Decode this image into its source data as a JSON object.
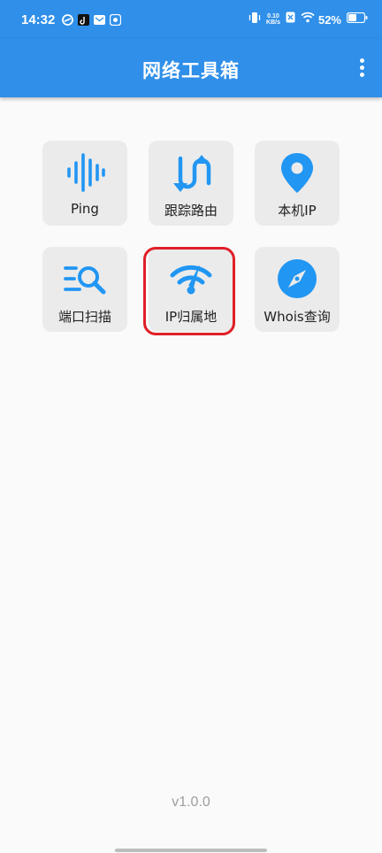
{
  "status_bar": {
    "time": "14:32",
    "net_speed_value": "0.10",
    "net_speed_unit": "KB/s",
    "battery": "52%"
  },
  "app_bar": {
    "title": "网络工具箱"
  },
  "tools": [
    {
      "label": "Ping",
      "icon": "waveform-icon"
    },
    {
      "label": "跟踪路由",
      "icon": "route-arrows-icon"
    },
    {
      "label": "本机IP",
      "icon": "location-pin-icon"
    },
    {
      "label": "端口扫描",
      "icon": "list-search-icon"
    },
    {
      "label": "IP归属地",
      "icon": "signal-gauge-icon"
    },
    {
      "label": "Whois查询",
      "icon": "compass-icon"
    }
  ],
  "footer": {
    "version": "v1.0.0"
  },
  "colors": {
    "primary": "#2f8fe9",
    "icon_blue": "#2196f3",
    "tile_bg": "#ebebeb",
    "highlight": "#e01f26"
  }
}
